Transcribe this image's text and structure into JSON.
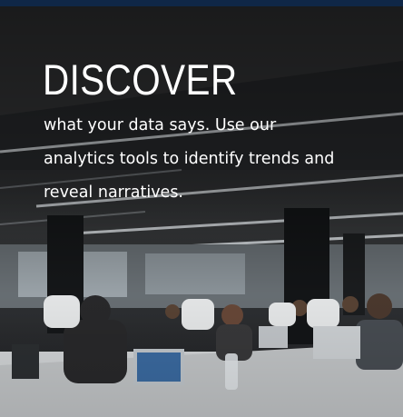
{
  "hero": {
    "headline": "DISCOVER",
    "body": "what your data says. Use our analytics tools to identify trends and reveal narratives."
  },
  "colors": {
    "topbar": "#0f2747",
    "text": "#ffffff"
  }
}
